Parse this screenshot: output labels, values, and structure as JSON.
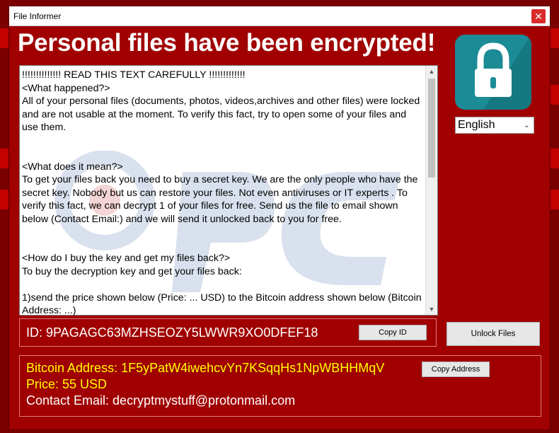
{
  "window": {
    "title": "File Informer",
    "close_glyph": "✕"
  },
  "headline": "Personal files have been encrypted!",
  "message": {
    "lines": [
      "!!!!!!!!!!!!!! READ THIS TEXT CAREFULLY !!!!!!!!!!!!!",
      "<What happened?>",
      "All of your personal files (documents, photos, videos,archives and other files) were locked and are not usable at the moment. To verify this fact, try to open some of your files and use them.",
      "",
      "<What does it mean?>",
      "To get your files back you need to buy a secret key. We are the only people who have the secret key. Nobody but us can restore your files. Not even antiviruses or IT experts . To verify this fact, we can decrypt 1 of your files for free. Send us the file to email shown below (Contact Email:) and we will send it unlocked back to you for free.",
      "",
      "<How do I buy the key and get my files back?>",
      "To buy the decryption key and get your files back:",
      "",
      "1)send the price shown below (Price: ... USD) to the Bitcoin address shown below (Bitcoin Address: ...)"
    ]
  },
  "language": {
    "selected": "English"
  },
  "id_section": {
    "id_text": "ID: 9PAGAGC63MZHSEOZY5LWWR9XO0DFEF18",
    "copy_label": "Copy ID"
  },
  "unlock_label": "Unlock Files",
  "payment": {
    "bitcoin_line": "Bitcoin Address: 1F5yPatW4iwehcvYn7KSqqHs1NpWBHHMqV",
    "price_line": "Price: 55 USD",
    "email_line": "Contact Email: decryptmystuff@protonmail.com",
    "copy_address_label": "Copy Address"
  },
  "colors": {
    "window_bg": "#a00000",
    "headline": "#ffffff",
    "btc_text": "#ffff00",
    "lock_tile": "#1b8b96"
  },
  "icons": {
    "lock": "lock-icon",
    "close": "close-icon",
    "dropdown": "chevron-down-icon"
  }
}
